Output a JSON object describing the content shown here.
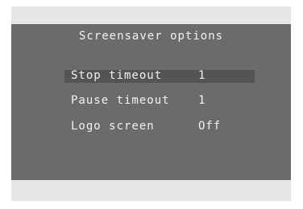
{
  "title": "Screensaver options",
  "items": [
    {
      "label": "Stop timeout",
      "value": "1",
      "selected": true
    },
    {
      "label": "Pause timeout",
      "value": "1",
      "selected": false
    },
    {
      "label": "Logo screen",
      "value": "Off",
      "selected": false
    }
  ],
  "colors": {
    "outer_background": "#e6e6e6",
    "panel_background": "#6b6b6b",
    "selection_highlight": "#545454",
    "text": "#f2f2f2"
  }
}
